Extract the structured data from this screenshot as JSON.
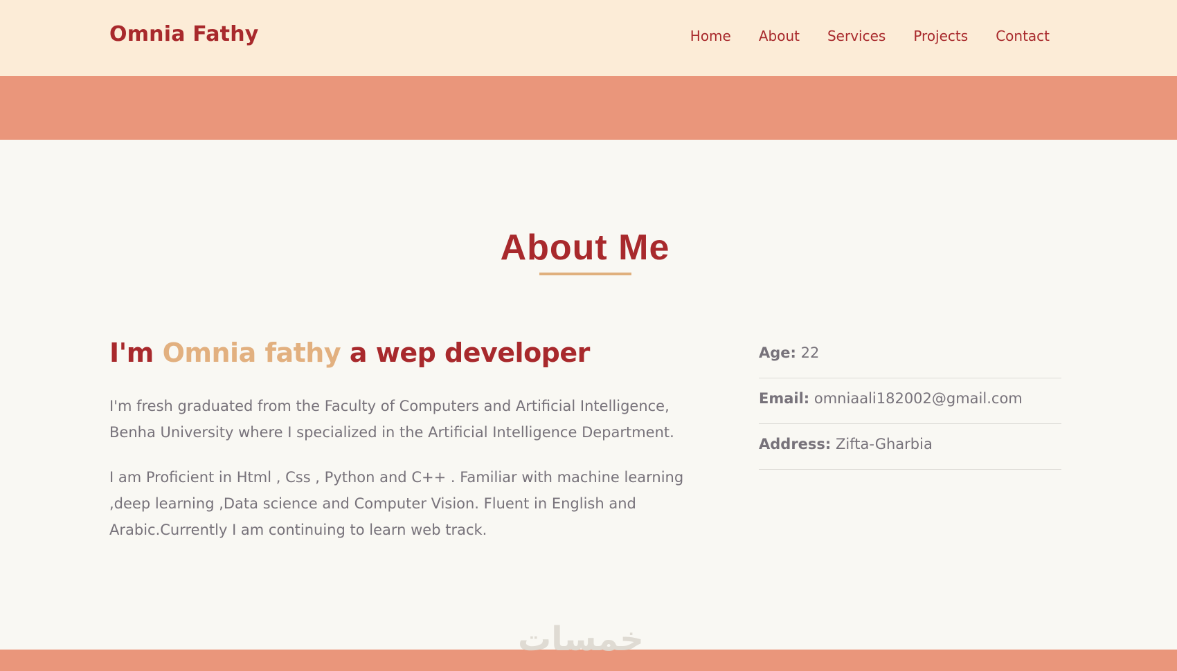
{
  "navbar": {
    "brand": "Omnia Fathy",
    "links": [
      "Home",
      "About",
      "Services",
      "Projects",
      "Contact"
    ]
  },
  "about": {
    "title": "About Me",
    "headline_prefix": "I'm ",
    "headline_name": "Omnia fathy",
    "headline_suffix": " a wep developer",
    "paragraphs": [
      "I'm fresh graduated from the Faculty of Computers and Artificial Intelligence, Benha University where I specialized in the Artificial Intelligence Department.",
      "I am Proficient in Html , Css , Python and C++ . Familiar with machine learning ,deep learning ,Data science and Computer Vision. Fluent in English and Arabic.Currently I am continuing to learn web track."
    ],
    "info": [
      {
        "label": "Age:",
        "value": " 22"
      },
      {
        "label": "Email:",
        "value": " omniaali182002@gmail.com"
      },
      {
        "label": "Address:",
        "value": " Zifta-Gharbia"
      }
    ]
  },
  "watermark": "خمسات",
  "colors": {
    "brand": "#a8292c",
    "accent": "#e2b07f",
    "navbar_bg": "#fcecd7",
    "band": "#ea967b",
    "page_bg": "#f9f8f3",
    "text": "#77727a"
  }
}
